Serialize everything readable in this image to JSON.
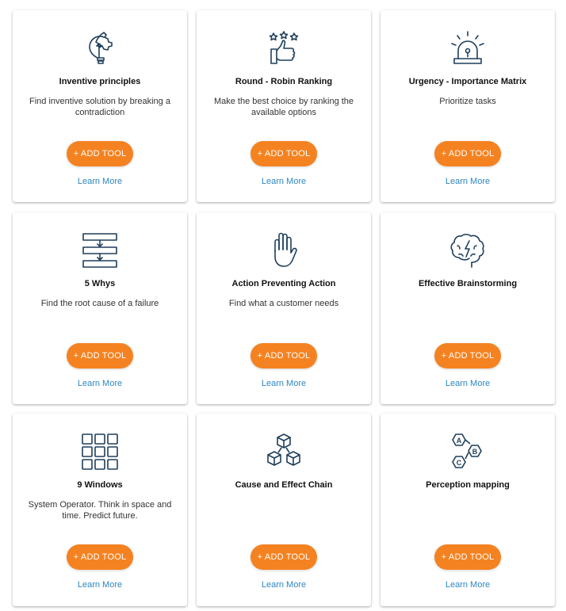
{
  "cards": [
    {
      "title": "Inventive principles",
      "description": "Find inventive solution by breaking a contradiction",
      "icon": "lightbulb-puzzle-icon",
      "button": "+ ADD TOOL",
      "link": "Learn More"
    },
    {
      "title": "Round - Robin Ranking",
      "description": "Make the best choice by ranking the available options",
      "icon": "thumbs-up-stars-icon",
      "button": "+ ADD TOOL",
      "link": "Learn More"
    },
    {
      "title": "Urgency - Importance Matrix",
      "description": "Prioritize tasks",
      "icon": "alarm-siren-icon",
      "button": "+ ADD TOOL",
      "link": "Learn More"
    },
    {
      "title": "5 Whys",
      "description": "Find the root cause of a failure",
      "icon": "stacked-steps-icon",
      "button": "+ ADD TOOL",
      "link": "Learn More"
    },
    {
      "title": "Action Preventing Action",
      "description": "Find what a customer needs",
      "icon": "raised-hand-icon",
      "button": "+ ADD TOOL",
      "link": "Learn More"
    },
    {
      "title": "Effective Brainstorming",
      "description": "",
      "icon": "brain-lightning-icon",
      "button": "+ ADD TOOL",
      "link": "Learn More"
    },
    {
      "title": "9 Windows",
      "description": "System Operator. Think in space and time. Predict future.",
      "icon": "nine-grid-icon",
      "button": "+ ADD TOOL",
      "link": "Learn More"
    },
    {
      "title": "Cause and Effect Chain",
      "description": "",
      "icon": "cubes-chain-icon",
      "button": "+ ADD TOOL",
      "link": "Learn More"
    },
    {
      "title": "Perception mapping",
      "description": "",
      "icon": "abc-hexagons-icon",
      "button": "+ ADD TOOL",
      "link": "Learn More"
    }
  ],
  "colors": {
    "accent": "#f58220",
    "link": "#2e86c1",
    "icon_stroke": "#1f3f5b"
  }
}
